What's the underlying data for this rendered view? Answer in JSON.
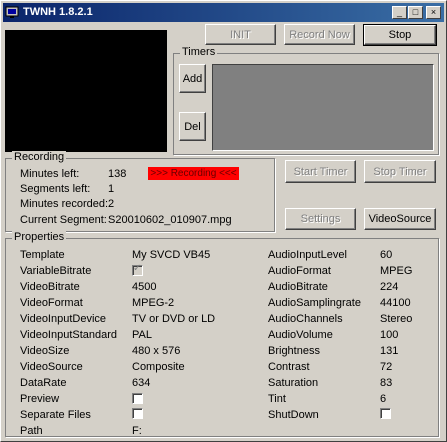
{
  "window": {
    "title": "TWNH 1.8.2.1"
  },
  "top_buttons": {
    "init": "INIT",
    "record_now": "Record Now",
    "stop": "Stop"
  },
  "timers": {
    "legend": "Timers",
    "add": "Add",
    "del": "Del"
  },
  "recording": {
    "legend": "Recording",
    "minutes_left_label": "Minutes left:",
    "minutes_left_value": "138",
    "status_badge": ">>> Recording <<<",
    "segments_left_label": "Segments left:",
    "segments_left_value": "1",
    "minutes_recorded_label": "Minutes recorded:",
    "minutes_recorded_value": "2",
    "current_segment_label": "Current Segment:",
    "current_segment_value": "S20010602_010907.mpg"
  },
  "side_buttons": {
    "start_timer": "Start Timer",
    "stop_timer": "Stop Timer",
    "settings": "Settings",
    "video_source": "VideoSource"
  },
  "properties": {
    "legend": "Properties",
    "left": [
      {
        "label": "Template",
        "value": "My SVCD VB45"
      },
      {
        "label": "VariableBitrate",
        "checked": true
      },
      {
        "label": "VideoBitrate",
        "value": "4500"
      },
      {
        "label": "VideoFormat",
        "value": "MPEG-2"
      },
      {
        "label": "VideoInputDevice",
        "value": "TV or DVD or LD"
      },
      {
        "label": "VideoInputStandard",
        "value": "PAL"
      },
      {
        "label": "VideoSize",
        "value": "480 x 576"
      },
      {
        "label": "VideoSource",
        "value": "Composite"
      },
      {
        "label": "DataRate",
        "value": "634"
      },
      {
        "label": "Preview",
        "checked": false
      },
      {
        "label": "Separate Files",
        "checked": false
      },
      {
        "label": "Path",
        "value": "F:"
      }
    ],
    "right": [
      {
        "label": "AudioInputLevel",
        "value": "60"
      },
      {
        "label": "AudioFormat",
        "value": "MPEG"
      },
      {
        "label": "AudioBitrate",
        "value": "224"
      },
      {
        "label": "AudioSamplingrate",
        "value": "44100"
      },
      {
        "label": "AudioChannels",
        "value": "Stereo"
      },
      {
        "label": "AudioVolume",
        "value": "100"
      },
      {
        "label": "Brightness",
        "value": "131"
      },
      {
        "label": "Contrast",
        "value": "72"
      },
      {
        "label": "Saturation",
        "value": "83"
      },
      {
        "label": "Tint",
        "value": "6"
      },
      {
        "label": "ShutDown",
        "checked": false
      }
    ]
  },
  "colors": {
    "title_start": "#0a246a",
    "title_end": "#3a6ea5",
    "recording_badge": "#ff0000",
    "face": "#d4d0c8"
  }
}
